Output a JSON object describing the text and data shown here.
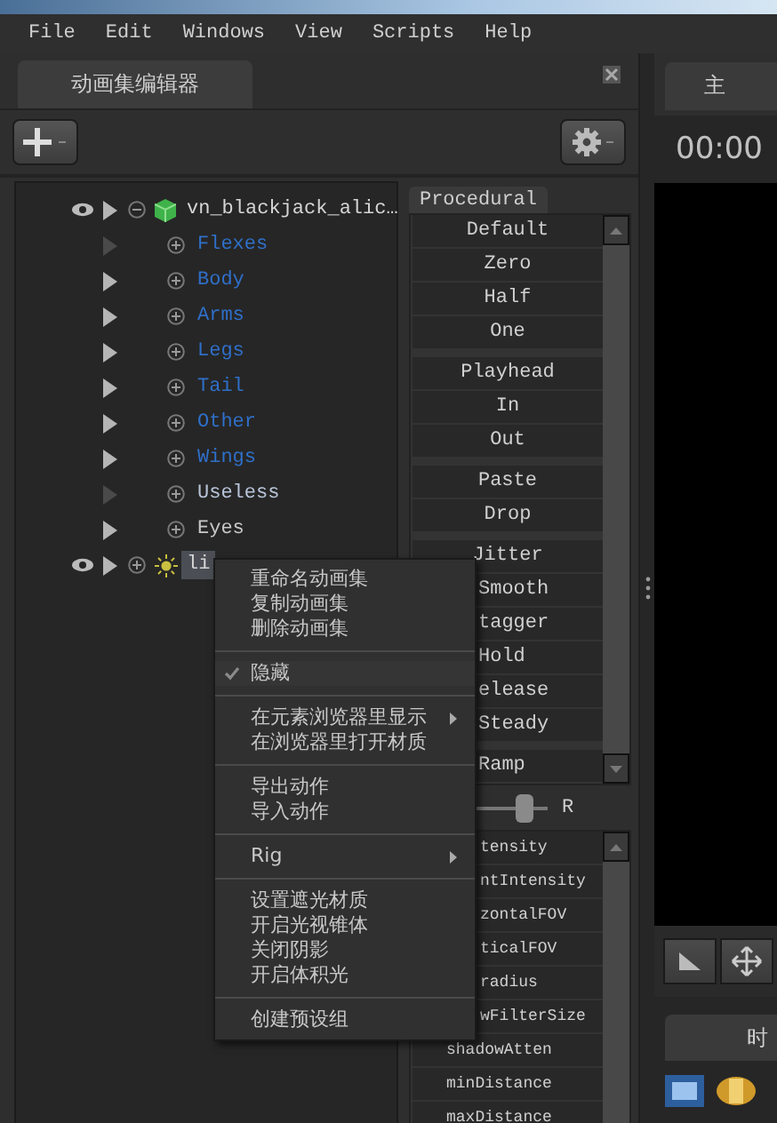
{
  "menu_bar": [
    "File",
    "Edit",
    "Windows",
    "View",
    "Scripts",
    "Help"
  ],
  "left_panel": {
    "tab": {
      "label": "动画集编辑器",
      "selected": true
    },
    "tree": [
      {
        "label": "vn_blackjack_alic…",
        "kind": "mesh",
        "visible": true,
        "expanded": true,
        "selected": false,
        "children": [
          {
            "label": "Flexes",
            "color": "#2f6fc8",
            "active": false
          },
          {
            "label": "Body",
            "color": "#2f6fc8",
            "active": true
          },
          {
            "label": "Arms",
            "color": "#2f6fc8",
            "active": true
          },
          {
            "label": "Legs",
            "color": "#2f6fc8",
            "active": true
          },
          {
            "label": "Tail",
            "color": "#2f6fc8",
            "active": true
          },
          {
            "label": "Other",
            "color": "#2f6fc8",
            "active": true
          },
          {
            "label": "Wings",
            "color": "#2f6fc8",
            "active": true
          },
          {
            "label": "Useless",
            "color": "#b8c4d8",
            "active": false
          },
          {
            "label": "Eyes",
            "color": "#c8c8c8",
            "active": true
          }
        ]
      },
      {
        "label": "li",
        "kind": "light",
        "visible": true,
        "expanded": false,
        "selected": true
      }
    ],
    "procedural": {
      "tab": {
        "label": "Procedural",
        "selected": true
      },
      "button_groups": [
        [
          "Default",
          "Zero",
          "Half",
          "One"
        ],
        [
          "Playhead",
          "In",
          "Out"
        ],
        [
          "Paste",
          "Drop"
        ],
        [
          "Jitter",
          "Smooth",
          "tagger",
          "Hold",
          "elease",
          "Steady"
        ]
      ],
      "dropdown": "Ramp",
      "slider": {
        "level": 0.8,
        "label": "R"
      },
      "attributes": [
        "tensity",
        "ntIntensity",
        "zontalFOV",
        "ticalFOV",
        "radius",
        "wFilterSize",
        "shadowAtten",
        "minDistance",
        "maxDistance"
      ]
    }
  },
  "context_menu": [
    {
      "kind": "item",
      "label": "重命名动画集",
      "checked": false,
      "submenu": false
    },
    {
      "kind": "item",
      "label": "复制动画集",
      "checked": false,
      "submenu": false
    },
    {
      "kind": "item",
      "label": "删除动画集",
      "checked": false,
      "submenu": false
    },
    {
      "kind": "separator"
    },
    {
      "kind": "item",
      "label": "隐藏",
      "checked": true,
      "submenu": false
    },
    {
      "kind": "separator"
    },
    {
      "kind": "item",
      "label": "在元素浏览器里显示",
      "checked": false,
      "submenu": true
    },
    {
      "kind": "item",
      "label": "在浏览器里打开材质",
      "checked": false,
      "submenu": false
    },
    {
      "kind": "separator"
    },
    {
      "kind": "item",
      "label": "导出动作",
      "checked": false,
      "submenu": false
    },
    {
      "kind": "item",
      "label": "导入动作",
      "checked": false,
      "submenu": false
    },
    {
      "kind": "separator"
    },
    {
      "kind": "item",
      "label": "Rig",
      "checked": false,
      "submenu": true
    },
    {
      "kind": "separator"
    },
    {
      "kind": "item",
      "label": "设置遮光材质",
      "checked": false,
      "submenu": false
    },
    {
      "kind": "item",
      "label": "开启光视锥体",
      "checked": false,
      "submenu": false
    },
    {
      "kind": "item",
      "label": "关闭阴影",
      "checked": false,
      "submenu": false
    },
    {
      "kind": "item",
      "label": "开启体积光",
      "checked": false,
      "submenu": false
    },
    {
      "kind": "separator"
    },
    {
      "kind": "item",
      "label": "创建预设组",
      "checked": false,
      "submenu": false
    }
  ],
  "right_panel": {
    "tab": {
      "label": "主",
      "selected": true
    },
    "time": "00:00",
    "footer_tab": "时"
  }
}
